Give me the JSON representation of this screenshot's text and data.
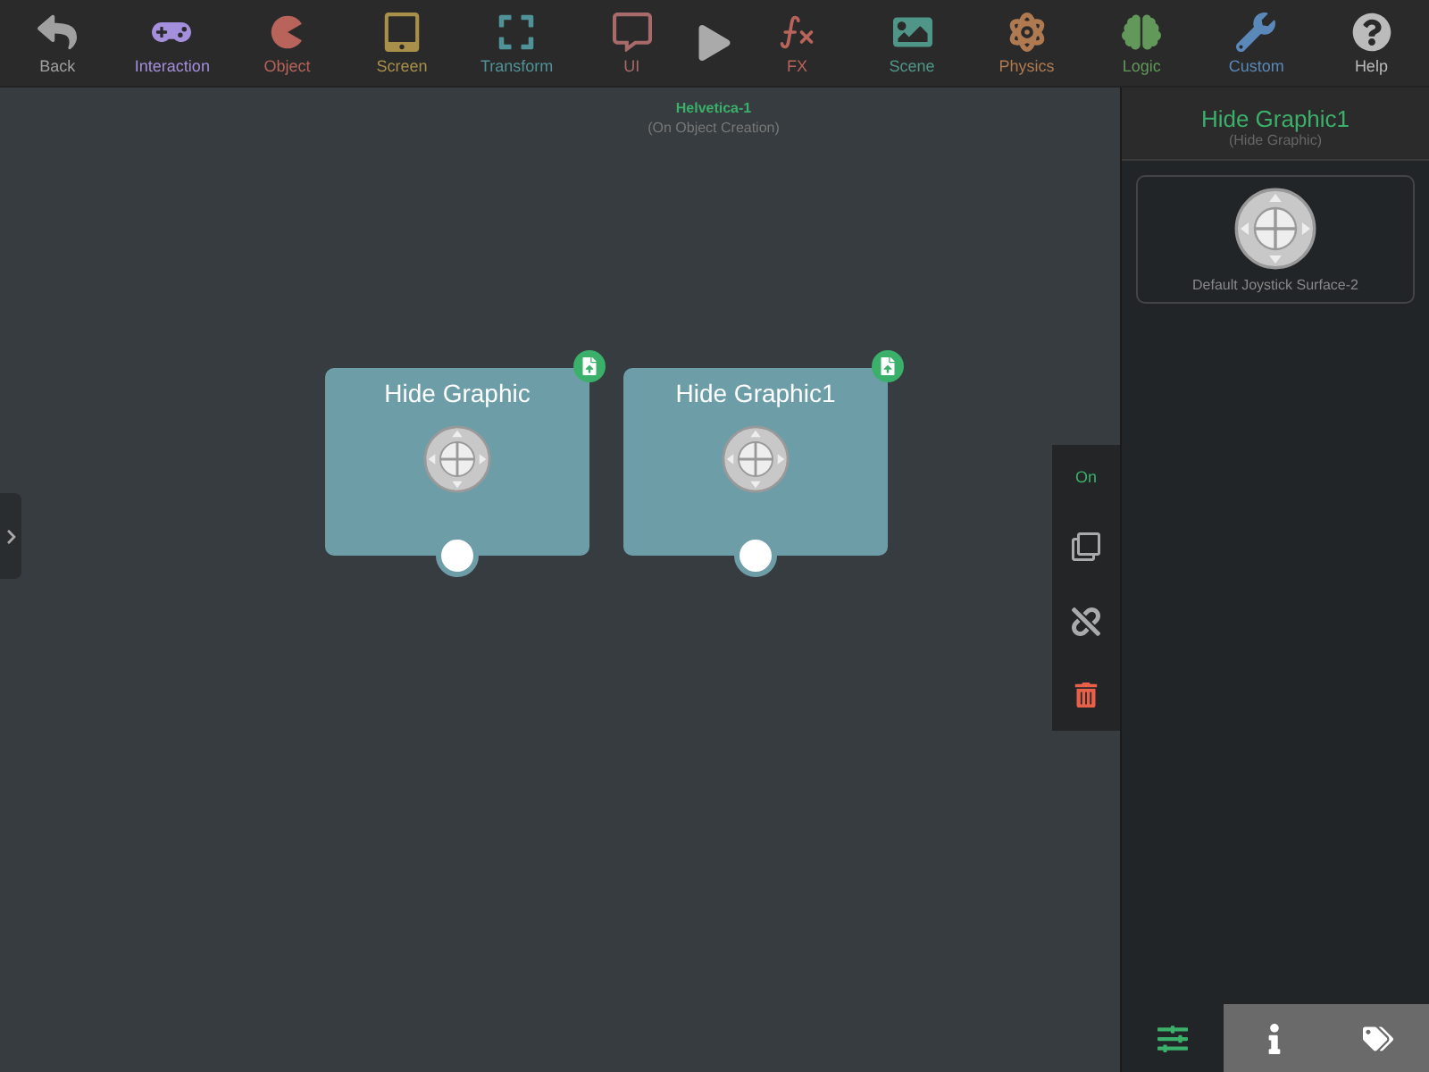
{
  "toolbar": [
    {
      "label": "Back",
      "color": "#a0a0a0"
    },
    {
      "label": "Interaction",
      "color": "#a48fdc"
    },
    {
      "label": "Object",
      "color": "#b8645a"
    },
    {
      "label": "Screen",
      "color": "#a8904a"
    },
    {
      "label": "Transform",
      "color": "#4f9298"
    },
    {
      "label": "UI",
      "color": "#a86a6a"
    },
    {
      "label": "FX",
      "color": "#b8645a"
    },
    {
      "label": "Scene",
      "color": "#4f9688"
    },
    {
      "label": "Physics",
      "color": "#b07a50"
    },
    {
      "label": "Logic",
      "color": "#62985a"
    },
    {
      "label": "Custom",
      "color": "#5a88b8"
    },
    {
      "label": "Help",
      "color": "#bbbbbb"
    }
  ],
  "canvas": {
    "title": "Helvetica-1",
    "subtitle": "(On Object Creation)",
    "nodes": [
      {
        "title": "Hide Graphic"
      },
      {
        "title": "Hide Graphic1"
      }
    ],
    "tools": {
      "toggle": "On"
    }
  },
  "inspector": {
    "title": "Hide Graphic1",
    "subtitle": "(Hide Graphic)",
    "asset": "Default Joystick Surface-2",
    "tabs": [
      {
        "selected": true
      },
      {
        "selected": false
      },
      {
        "selected": false
      }
    ]
  }
}
